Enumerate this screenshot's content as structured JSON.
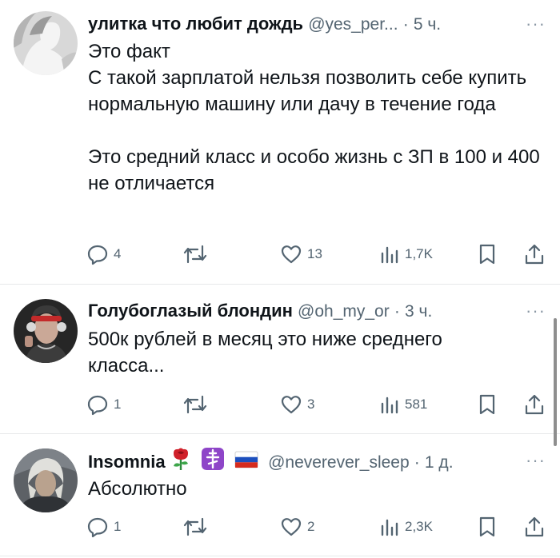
{
  "tweets": [
    {
      "name": "улитка что любит дождь",
      "handle": "@yes_per...",
      "dot": "·",
      "time": "5 ч.",
      "more": "···",
      "text": "Это факт\nС такой зарплатой нельзя позволить себе купить нормальную машину или дачу в течение года\n\nЭто средний класс и особо жизнь с ЗП в 100 и 400 не отличается",
      "replies": "4",
      "retweets": "",
      "likes": "13",
      "views": "1,7K"
    },
    {
      "name": "Голубоглазый блондин",
      "handle": "@oh_my_or",
      "dot": "·",
      "time": "3 ч.",
      "more": "···",
      "text": "500к рублей в месяц это ниже среднего класса...",
      "replies": "1",
      "retweets": "",
      "likes": "3",
      "views": "581"
    },
    {
      "name": "Insomnia",
      "emojis": [
        "rose-emoji",
        "orthodox-cross-emoji",
        "russian-flag-emoji"
      ],
      "handle": "@neverever_sleep",
      "dot": "·",
      "time": "1 д.",
      "more": "···",
      "text": "Абсолютно",
      "replies": "1",
      "retweets": "",
      "likes": "2",
      "views": "2,3K"
    }
  ],
  "icons": {
    "reply": "reply-icon",
    "retweet": "retweet-icon",
    "like": "heart-icon",
    "views": "views-icon",
    "bookmark": "bookmark-icon",
    "share": "share-icon"
  },
  "colors": {
    "text": "#0f1419",
    "secondary": "#536471",
    "divider": "#e7e9ea"
  }
}
